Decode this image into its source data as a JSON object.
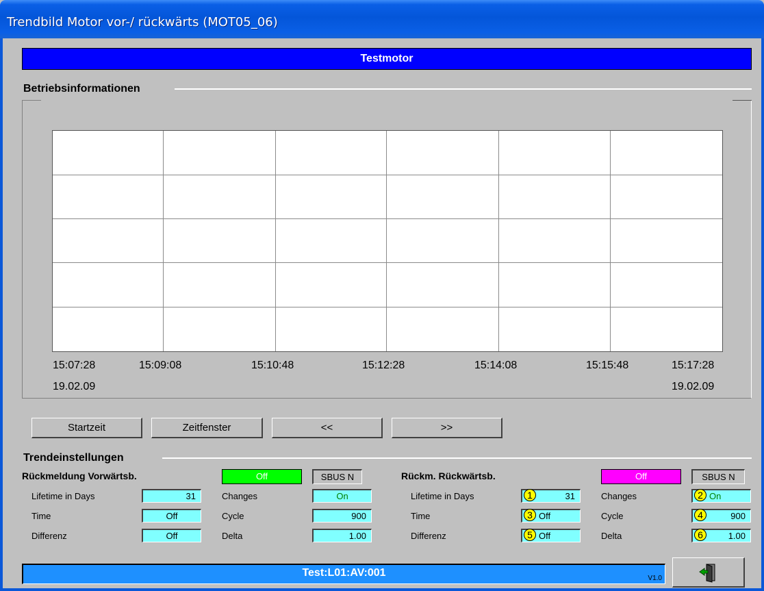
{
  "window": {
    "title": "Trendbild Motor vor-/ rückwärts  (MOT05_06)"
  },
  "header": {
    "banner": "Testmotor"
  },
  "operating_info": {
    "title": "Betriebsinformationen",
    "time_labels": [
      "15:07:28",
      "15:09:08",
      "15:10:48",
      "15:12:28",
      "15:14:08",
      "15:15:48",
      "15:17:28"
    ],
    "start_date": "19.02.09",
    "end_date": "19.02.09"
  },
  "buttons": {
    "start_time": "Startzeit",
    "time_window": "Zeitfenster",
    "back": "<<",
    "forward": ">>"
  },
  "trend_settings": {
    "title": "Trendeinstellungen",
    "left": {
      "name": "Rückmeldung Vorwärtsb.",
      "status": "Off",
      "status_color": "#00ff00",
      "bus": "SBUS N",
      "lifetime_label": "Lifetime in Days",
      "lifetime": "31",
      "time_label": "Time",
      "time": "Off",
      "diff_label": "Differenz",
      "diff": "Off",
      "changes_label": "Changes",
      "changes": "On",
      "cycle_label": "Cycle",
      "cycle": "900",
      "delta_label": "Delta",
      "delta": "1.00"
    },
    "right": {
      "name": "Rückm. Rückwärtsb.",
      "status": "Off",
      "status_color": "#ff00ff",
      "bus": "SBUS N",
      "lifetime_label": "Lifetime in Days",
      "lifetime": "31",
      "time_label": "Time",
      "time": "Off",
      "diff_label": "Differenz",
      "diff": "Off",
      "changes_label": "Changes",
      "changes": "On",
      "cycle_label": "Cycle",
      "cycle": "900",
      "delta_label": "Delta",
      "delta": "1.00",
      "markers": [
        "1",
        "2",
        "3",
        "4",
        "5",
        "6"
      ]
    }
  },
  "footer": {
    "tag": "Test:L01:AV:001",
    "version": "V1.0"
  },
  "colors": {
    "banner": "#0000ff",
    "footer": "#1e90ff",
    "field": "#80ffff",
    "marker": "#ffff00"
  },
  "icons": {
    "exit": "exit-door-icon"
  }
}
